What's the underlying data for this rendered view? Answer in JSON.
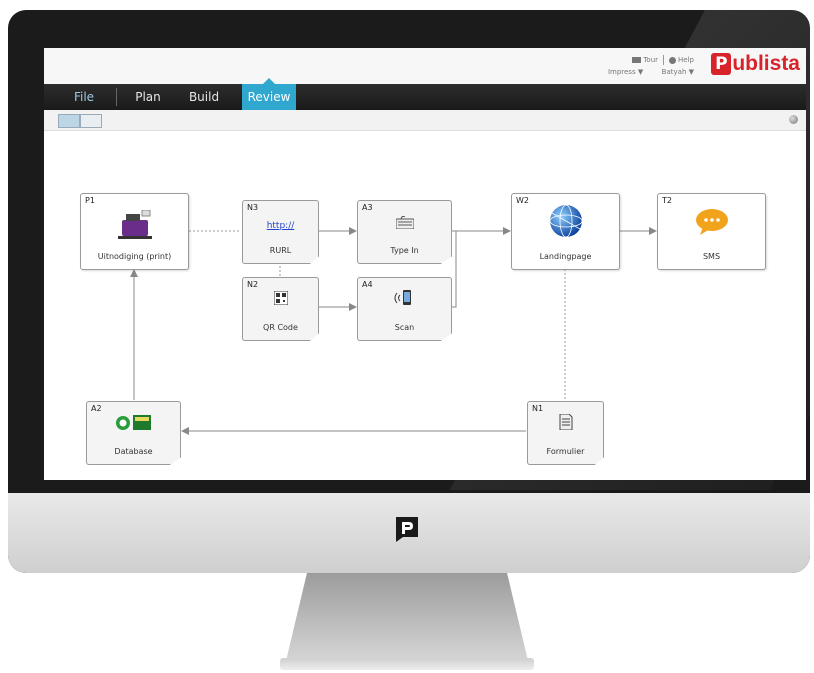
{
  "header": {
    "tour": "Tour",
    "help": "Help",
    "impress": "Impress ▼",
    "user": "Batyah ▼",
    "logo_letter": "P",
    "logo_text": "ublista"
  },
  "menu": {
    "tabs": [
      {
        "label": "File"
      },
      {
        "label": "Plan"
      },
      {
        "label": "Build"
      },
      {
        "label": "Review"
      }
    ],
    "active": "Review"
  },
  "flow": {
    "nodes": [
      {
        "id": "P1",
        "label": "Uitnodiging (print)",
        "icon": "printer-icon"
      },
      {
        "id": "N3",
        "label": "RURL",
        "link": "http://",
        "icon": "link-icon"
      },
      {
        "id": "N2",
        "label": "QR Code",
        "icon": "qr-code-icon"
      },
      {
        "id": "A3",
        "label": "Type In",
        "icon": "keyboard-icon"
      },
      {
        "id": "A4",
        "label": "Scan",
        "icon": "phone-icon"
      },
      {
        "id": "W2",
        "label": "Landingpage",
        "icon": "globe-icon"
      },
      {
        "id": "T2",
        "label": "SMS",
        "icon": "chat-bubble-icon"
      },
      {
        "id": "A2",
        "label": "Database",
        "icon": "database-icon"
      },
      {
        "id": "N1",
        "label": "Formulier",
        "icon": "form-icon"
      }
    ]
  },
  "colors": {
    "accent": "#2fa7cf",
    "brand": "#d8232a",
    "menubar": "#222222"
  }
}
